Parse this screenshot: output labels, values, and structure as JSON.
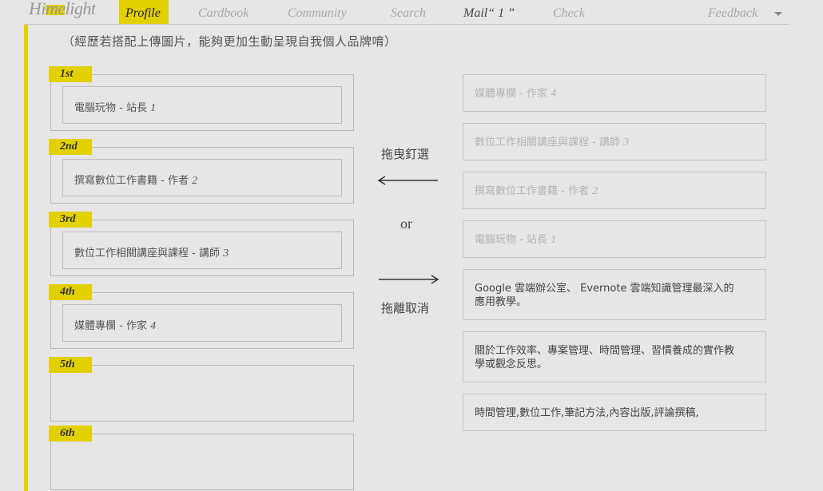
{
  "nav": {
    "logo": "Himelight",
    "items": [
      "Profile",
      "Cardbook",
      "Community",
      "Search",
      "Mail“ 1 ”",
      "Check"
    ],
    "feedback": "Feedback"
  },
  "hint": "（經歷若搭配上傳圖片，能夠更加生動呈現自我個人品牌唷）",
  "slots": [
    {
      "tag": "1st",
      "text": "電腦玩物 - 站長",
      "num": "1"
    },
    {
      "tag": "2nd",
      "text": "撰寫數位工作書籍 - 作者",
      "num": "2"
    },
    {
      "tag": "3rd",
      "text": "數位工作相關講座與課程 - 講師",
      "num": "3"
    },
    {
      "tag": "4th",
      "text": "媒體專欄 - 作家",
      "num": "4"
    },
    {
      "tag": "5th",
      "text": "",
      "num": ""
    },
    {
      "tag": "6th",
      "text": "",
      "num": ""
    }
  ],
  "middle": {
    "pin_label": "拖曳釘選",
    "or": "or",
    "unpin_label": "拖離取消"
  },
  "right_cards": [
    {
      "text": "媒體專欄 - 作家",
      "num": "4"
    },
    {
      "text": "數位工作相關講座與課程 - 講師",
      "num": "3"
    },
    {
      "text": "撰寫數位工作書籍 - 作者",
      "num": "2"
    },
    {
      "text": "電腦玩物 - 站長",
      "num": "1"
    },
    {
      "line1": "Google 雲端辦公室、 Evernote 雲端知識管理最深入的",
      "line2": "應用教學。"
    },
    {
      "line1": "關於工作效率、專案管理、時間管理、習慣養成的實作教",
      "line2": "學或觀念反思。"
    },
    {
      "line1": "時間管理,數位工作,筆記方法,內容出版,評論撰稿,"
    }
  ],
  "colors": {
    "accent": "#e2d000",
    "background": "#e6e6e6",
    "faded_text": "#b5b5b5"
  },
  "icons": {
    "left_arrow": "arrow-left-icon",
    "right_arrow": "arrow-right-icon",
    "dropdown": "caret-down-icon"
  }
}
